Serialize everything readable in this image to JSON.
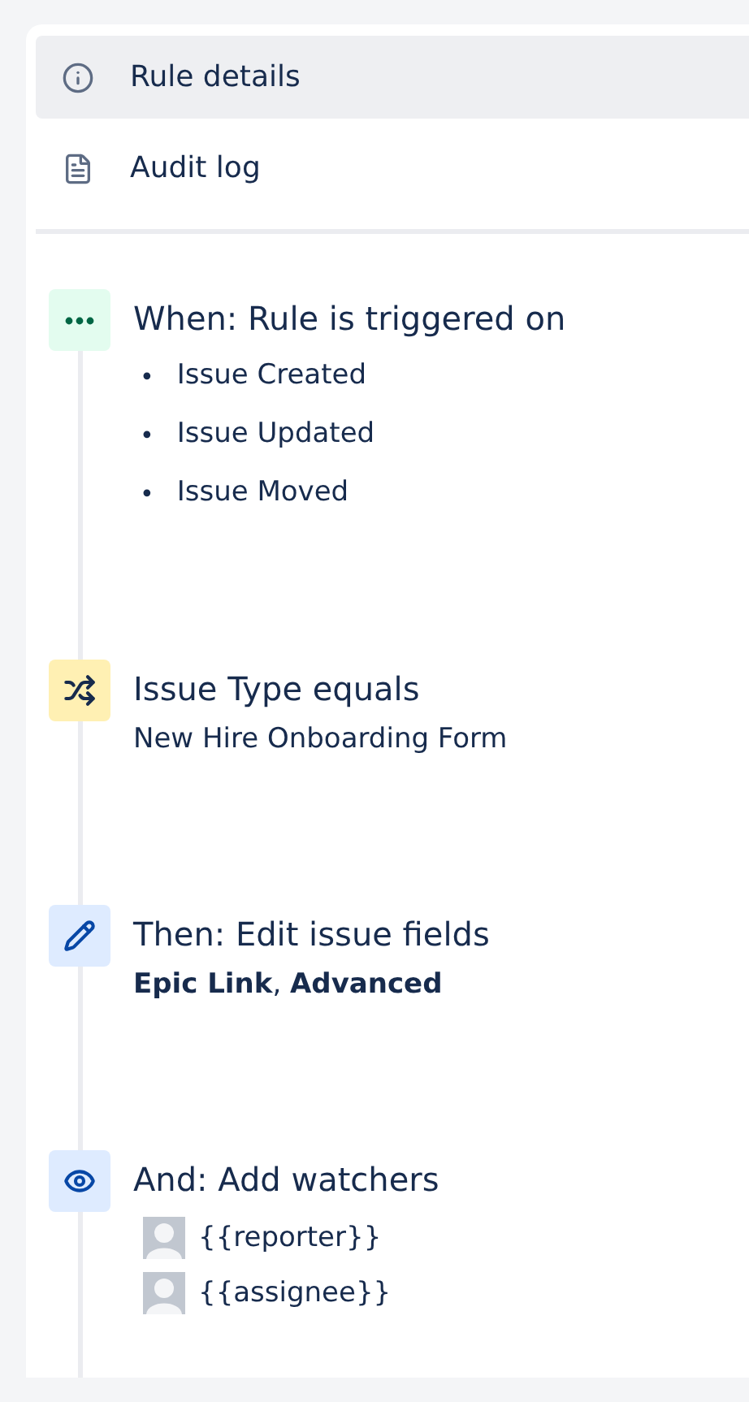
{
  "nav": [
    {
      "label": "Rule details",
      "selected": true
    },
    {
      "label": "Audit log",
      "selected": false
    }
  ],
  "steps": [
    {
      "kind": "trigger",
      "title": "When: Rule is triggered on",
      "details": {
        "kind": "bullets",
        "marker": "•",
        "items": [
          "Issue Created",
          "Issue Updated",
          "Issue Moved"
        ]
      }
    },
    {
      "kind": "condition",
      "title": "Issue Type equals",
      "details": {
        "kind": "text",
        "text": "New Hire Onboarding Form"
      }
    },
    {
      "kind": "action",
      "title": "Then: Edit issue fields",
      "details": {
        "kind": "text",
        "text": "**Epic Link**, **Advanced**"
      }
    },
    {
      "kind": "action",
      "title": "And: Add watchers",
      "details": {
        "kind": "users",
        "items": [
          "{{reporter}}",
          "{{assignee}}"
        ]
      }
    }
  ]
}
